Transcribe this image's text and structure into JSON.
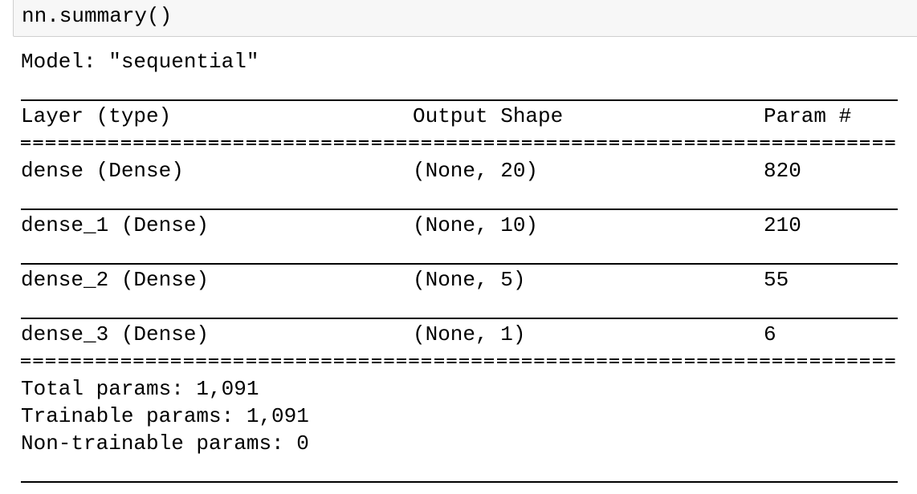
{
  "input": {
    "code": "nn.summary()"
  },
  "summary": {
    "model_line": "Model: \"sequential\"",
    "headers": {
      "layer": "Layer (type)",
      "output": "Output Shape",
      "params": "Param #"
    },
    "rows": [
      {
        "layer": "dense (Dense)",
        "output": "(None, 20)",
        "params": "820"
      },
      {
        "layer": "dense_1 (Dense)",
        "output": "(None, 10)",
        "params": "210"
      },
      {
        "layer": "dense_2 (Dense)",
        "output": "(None, 5)",
        "params": "55"
      },
      {
        "layer": "dense_3 (Dense)",
        "output": "(None, 1)",
        "params": "6"
      }
    ],
    "total": "Total params: 1,091",
    "trainable": "Trainable params: 1,091",
    "non_trainable": "Non-trainable params: 0"
  }
}
